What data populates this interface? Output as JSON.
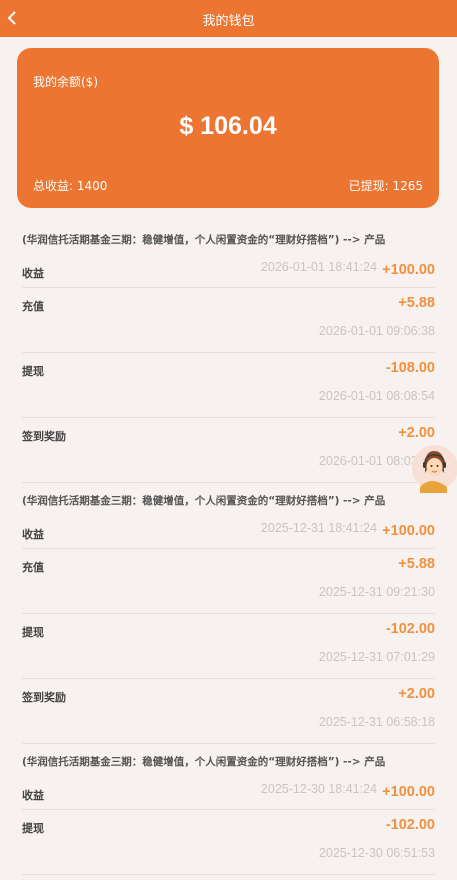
{
  "header": {
    "title": "我的钱包"
  },
  "wallet": {
    "balance_label": "我的余额($)",
    "balance": "$ 106.04",
    "total_income": "总收益: 1400",
    "withdrawn": "已提现: 1265"
  },
  "groups": [
    {
      "title": "(华润信托活期基金三期：稳健增值，个人闲置资金的“理财好搭档”) --> 产品",
      "records": [
        {
          "label": "收益",
          "amount": "+100.00",
          "time": "2026-01-01 18:41:24",
          "layout": "inline"
        },
        {
          "label": "充值",
          "amount": "+5.88",
          "time": "2026-01-01 09:06:38",
          "layout": "below"
        },
        {
          "label": "提现",
          "amount": "-108.00",
          "time": "2026-01-01 08:08:54",
          "layout": "below"
        },
        {
          "label": "签到奖励",
          "amount": "+2.00",
          "time": "2026-01-01 08:03:12",
          "layout": "below"
        }
      ]
    },
    {
      "title": "(华润信托活期基金三期：稳健增值，个人闲置资金的“理财好搭档”) --> 产品",
      "records": [
        {
          "label": "收益",
          "amount": "+100.00",
          "time": "2025-12-31 18:41:24",
          "layout": "inline"
        },
        {
          "label": "充值",
          "amount": "+5.88",
          "time": "2025-12-31 09:21:30",
          "layout": "below"
        },
        {
          "label": "提现",
          "amount": "-102.00",
          "time": "2025-12-31 07:01:29",
          "layout": "below"
        },
        {
          "label": "签到奖励",
          "amount": "+2.00",
          "time": "2025-12-31 06:58:18",
          "layout": "below"
        }
      ]
    },
    {
      "title": "(华润信托活期基金三期：稳健增值，个人闲置资金的“理财好搭档”) --> 产品",
      "records": [
        {
          "label": "收益",
          "amount": "+100.00",
          "time": "2025-12-30 18:41:24",
          "layout": "inline"
        },
        {
          "label": "提现",
          "amount": "-102.00",
          "time": "2025-12-30 06:51:53",
          "layout": "below"
        }
      ]
    }
  ],
  "icons": {
    "back": "chevron-left-icon",
    "support": "customer-service-avatar-icon"
  },
  "colors": {
    "brand": "#ec7531",
    "amount": "#f0913f",
    "time": "#c9c4c1",
    "background": "#f7f2ef"
  }
}
